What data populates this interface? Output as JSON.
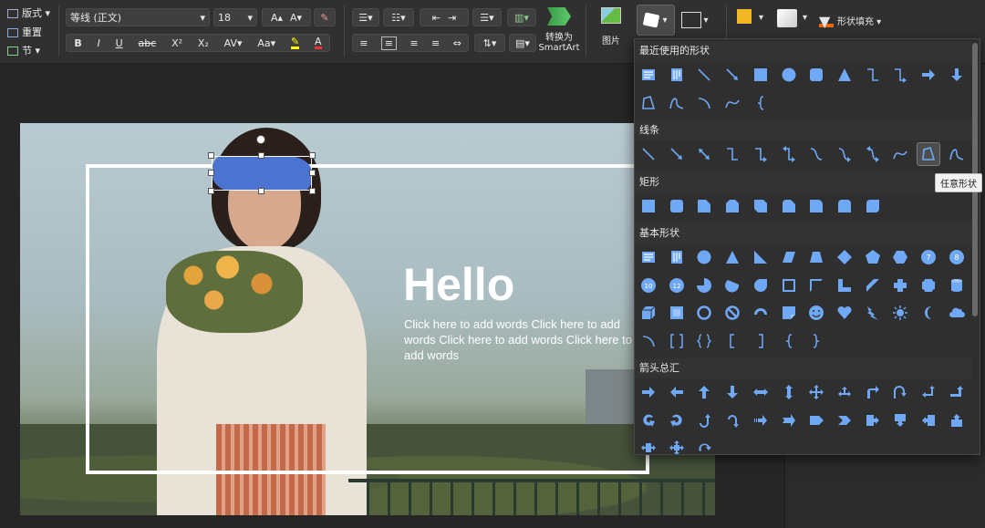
{
  "ribbon": {
    "left_group": [
      {
        "name": "layout",
        "label": "版式 ▾"
      },
      {
        "name": "reset",
        "label": "重置"
      },
      {
        "name": "section",
        "label": "节 ▾"
      }
    ],
    "font_name": "等线 (正文)",
    "font_size": "18",
    "smartart_label_line1": "转换为",
    "smartart_label_line2": "SmartArt",
    "picture_label": "图片",
    "shape_fill_label": "形状填充 ▾"
  },
  "gallery": {
    "sections": [
      {
        "title": "最近使用的形状",
        "shapes": [
          "text-box",
          "vertical-text-box",
          "line",
          "arrow-line",
          "rectangle",
          "oval",
          "rounded-rectangle",
          "triangle",
          "elbow-connector",
          "elbow-arrow-connector",
          "right-arrow",
          "down-arrow",
          "freeform",
          "scribble",
          "arc",
          "curve",
          "left-brace"
        ]
      },
      {
        "title": "线条",
        "shapes": [
          "line",
          "arrow-line",
          "double-arrow-line",
          "elbow-connector",
          "elbow-arrow-connector",
          "elbow-double-arrow",
          "curved-connector",
          "curved-arrow-connector",
          "curved-double-arrow",
          "curve",
          "freeform",
          "scribble"
        ]
      },
      {
        "title": "矩形",
        "shapes": [
          "rectangle",
          "rounded-rectangle",
          "snip-single-corner",
          "snip-same-side",
          "snip-diagonal",
          "snip-round-single",
          "round-single-corner",
          "round-same-side",
          "round-diagonal"
        ]
      },
      {
        "title": "基本形状",
        "shapes": [
          "text-box",
          "vertical-text-box",
          "oval",
          "triangle",
          "right-triangle",
          "parallelogram",
          "trapezoid",
          "diamond",
          "pentagon",
          "hexagon",
          "heptagon",
          "octagon",
          "decagon",
          "dodecagon",
          "pie",
          "chord",
          "teardrop",
          "frame",
          "half-frame",
          "l-shape",
          "diagonal-stripe",
          "cross",
          "plaque",
          "can",
          "cube",
          "bevel",
          "donut",
          "no-symbol",
          "block-arc",
          "folded-corner",
          "smiley-face",
          "heart",
          "lightning-bolt",
          "sun",
          "moon",
          "cloud",
          "arc",
          "double-bracket",
          "double-brace",
          "left-bracket",
          "right-bracket",
          "left-brace",
          "right-brace"
        ]
      },
      {
        "title": "箭头总汇",
        "shapes": [
          "right-arrow",
          "left-arrow",
          "up-arrow",
          "down-arrow",
          "left-right-arrow",
          "up-down-arrow",
          "quad-arrow",
          "left-right-up-arrow",
          "bent-arrow",
          "u-turn-arrow",
          "left-up-arrow",
          "bent-up-arrow",
          "curved-right-arrow",
          "curved-left-arrow",
          "curved-up-arrow",
          "curved-down-arrow",
          "striped-right-arrow",
          "notched-right-arrow",
          "pentagon-arrow",
          "chevron",
          "right-arrow-callout",
          "down-arrow-callout",
          "left-arrow-callout",
          "up-arrow-callout",
          "left-right-arrow-callout",
          "quad-arrow-callout",
          "circular-arrow"
        ]
      }
    ],
    "badge_numbers": {
      "heptagon": "7",
      "octagon": "8",
      "decagon": "10",
      "dodecagon": "12"
    },
    "tooltip": "任意形状",
    "accent": "#6fa8f5"
  },
  "slide": {
    "title": "Hello",
    "body": "Click here to add words Click here to add words Click here to add words Click here to add words"
  }
}
